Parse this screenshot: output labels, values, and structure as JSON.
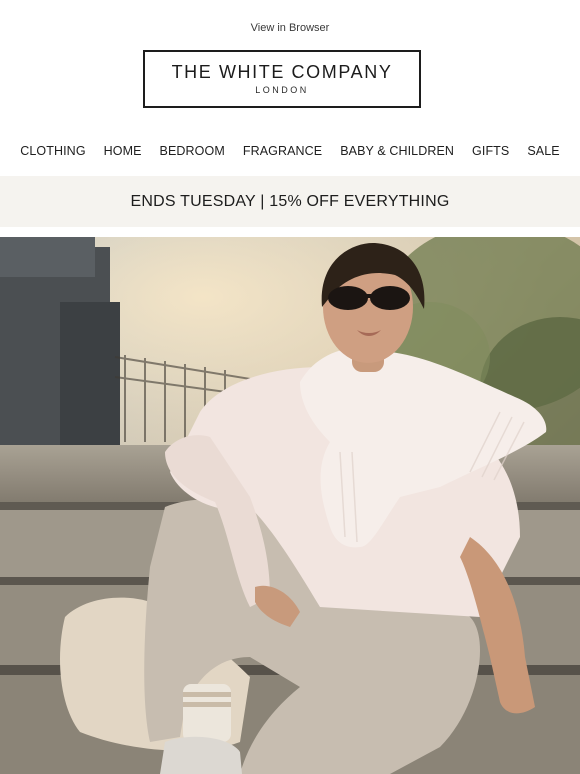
{
  "header": {
    "view_in_browser": "View in Browser",
    "logo_main": "THE WHITE COMPANY",
    "logo_sub": "LONDON"
  },
  "nav": {
    "items": [
      "CLOTHING",
      "HOME",
      "BEDROOM",
      "FRAGRANCE",
      "BABY & CHILDREN",
      "GIFTS",
      "SALE"
    ]
  },
  "promo": {
    "text": "ENDS TUESDAY | 15% OFF EVERYTHING"
  },
  "colors": {
    "promo_bg": "#f5f3ef",
    "text": "#1f1f1f"
  }
}
